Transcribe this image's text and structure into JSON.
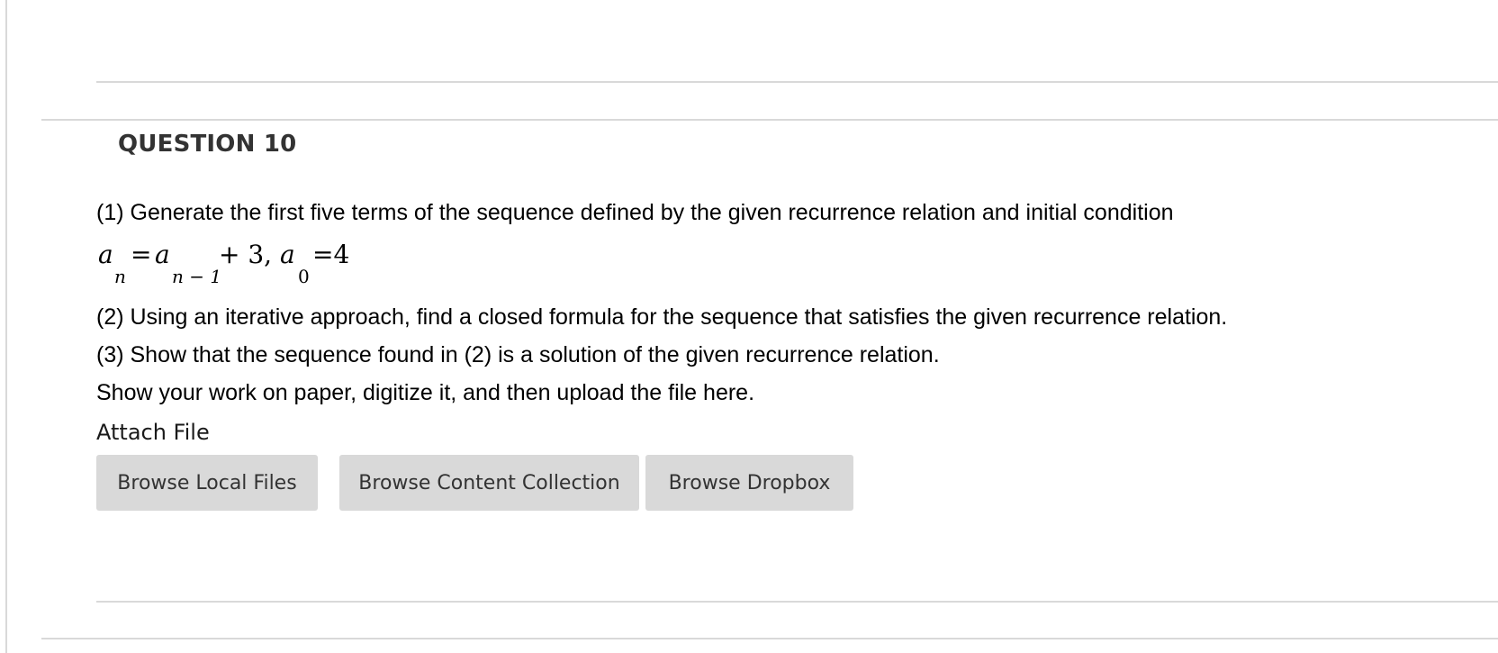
{
  "question": {
    "title": "QUESTION 10",
    "lines": [
      "(1) Generate the first five terms of the sequence defined by the given recurrence relation and initial condition",
      "(2) Using an iterative approach, find a closed formula for the sequence that satisfies the given recurrence relation.",
      "(3) Show that the sequence found in (2) is a solution of the given recurrence relation.",
      "Show your work on paper, digitize it, and then upload the file here."
    ],
    "formula": {
      "a1": "a",
      "sub_n": "n",
      "eq1": "=",
      "a2": "a",
      "sub_n1": "n − 1",
      "plus3": "+ 3,",
      "a3": "a",
      "sub_0": "0",
      "eq4": "=4"
    }
  },
  "attach": {
    "label": "Attach File",
    "buttons": [
      {
        "label": "Browse Local Files"
      },
      {
        "label": "Browse Content Collection"
      },
      {
        "label": "Browse Dropbox"
      }
    ]
  }
}
